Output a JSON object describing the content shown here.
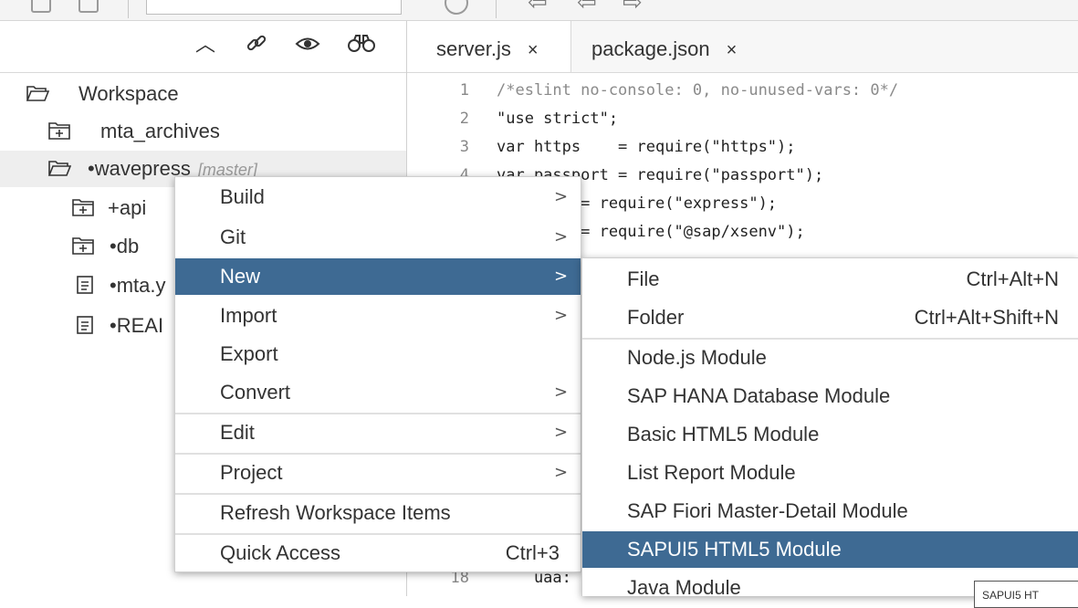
{
  "workspace_panel": {
    "tree": [
      {
        "label": "Workspace",
        "icon": "folder-open-icon",
        "tag": ""
      },
      {
        "label": "mta_archives",
        "icon": "folder-plus-icon",
        "tag": ""
      },
      {
        "label": "•wavepress",
        "icon": "folder-open-icon",
        "tag": "[master]"
      },
      {
        "label": "+api",
        "icon": "folder-plus-icon",
        "tag": ""
      },
      {
        "label": "•db",
        "icon": "folder-plus-icon",
        "tag": ""
      },
      {
        "label": "•mta.y",
        "icon": "file-icon",
        "tag": ""
      },
      {
        "label": "•REAI",
        "icon": "file-icon",
        "tag": ""
      }
    ]
  },
  "editor": {
    "tabs": [
      {
        "label": "server.js",
        "close": "×"
      },
      {
        "label": "package.json",
        "close": "×"
      }
    ],
    "lines": [
      {
        "n": "1",
        "code": "/*eslint no-console: 0, no-unused-vars: 0*/"
      },
      {
        "n": "2",
        "code": "\"use strict\";"
      },
      {
        "n": "3",
        "code": "var https    = require(\"https\");"
      },
      {
        "n": "4",
        "code": "var passport = require(\"passport\");"
      },
      {
        "n": "",
        "code": "    ess  = require(\"express\");"
      },
      {
        "n": "",
        "code": "    v    = require(\"@sap/xsenv\");"
      },
      {
        "n": "18",
        "code": "    uaa:"
      }
    ]
  },
  "context_menu": {
    "items": [
      {
        "label": "Build",
        "submenu": true,
        "shortcut": ""
      },
      {
        "label": "Git",
        "submenu": true,
        "shortcut": ""
      },
      {
        "label": "New",
        "submenu": true,
        "shortcut": ""
      },
      {
        "label": "Import",
        "submenu": true,
        "shortcut": ""
      },
      {
        "label": "Export",
        "submenu": false,
        "shortcut": ""
      },
      {
        "label": "Convert",
        "submenu": true,
        "shortcut": ""
      },
      {
        "label": "Edit",
        "submenu": true,
        "shortcut": ""
      },
      {
        "label": "Project",
        "submenu": true,
        "shortcut": ""
      },
      {
        "label": "Refresh Workspace Items",
        "submenu": false,
        "shortcut": ""
      },
      {
        "label": "Quick Access",
        "submenu": false,
        "shortcut": "Ctrl+3"
      }
    ],
    "chevron": ">"
  },
  "new_submenu": {
    "items": [
      {
        "label": "File",
        "shortcut": "Ctrl+Alt+N"
      },
      {
        "label": "Folder",
        "shortcut": "Ctrl+Alt+Shift+N"
      },
      {
        "label": "Node.js Module",
        "shortcut": ""
      },
      {
        "label": "SAP HANA Database Module",
        "shortcut": ""
      },
      {
        "label": "Basic HTML5 Module",
        "shortcut": ""
      },
      {
        "label": "List Report Module",
        "shortcut": ""
      },
      {
        "label": "SAP Fiori Master-Detail Module",
        "shortcut": ""
      },
      {
        "label": "SAPUI5 HTML5 Module",
        "shortcut": ""
      },
      {
        "label": "Java Module",
        "shortcut": ""
      }
    ]
  },
  "tooltip": {
    "text": "SAPUI5 HT"
  },
  "colors": {
    "highlight": "#3e6a93"
  }
}
